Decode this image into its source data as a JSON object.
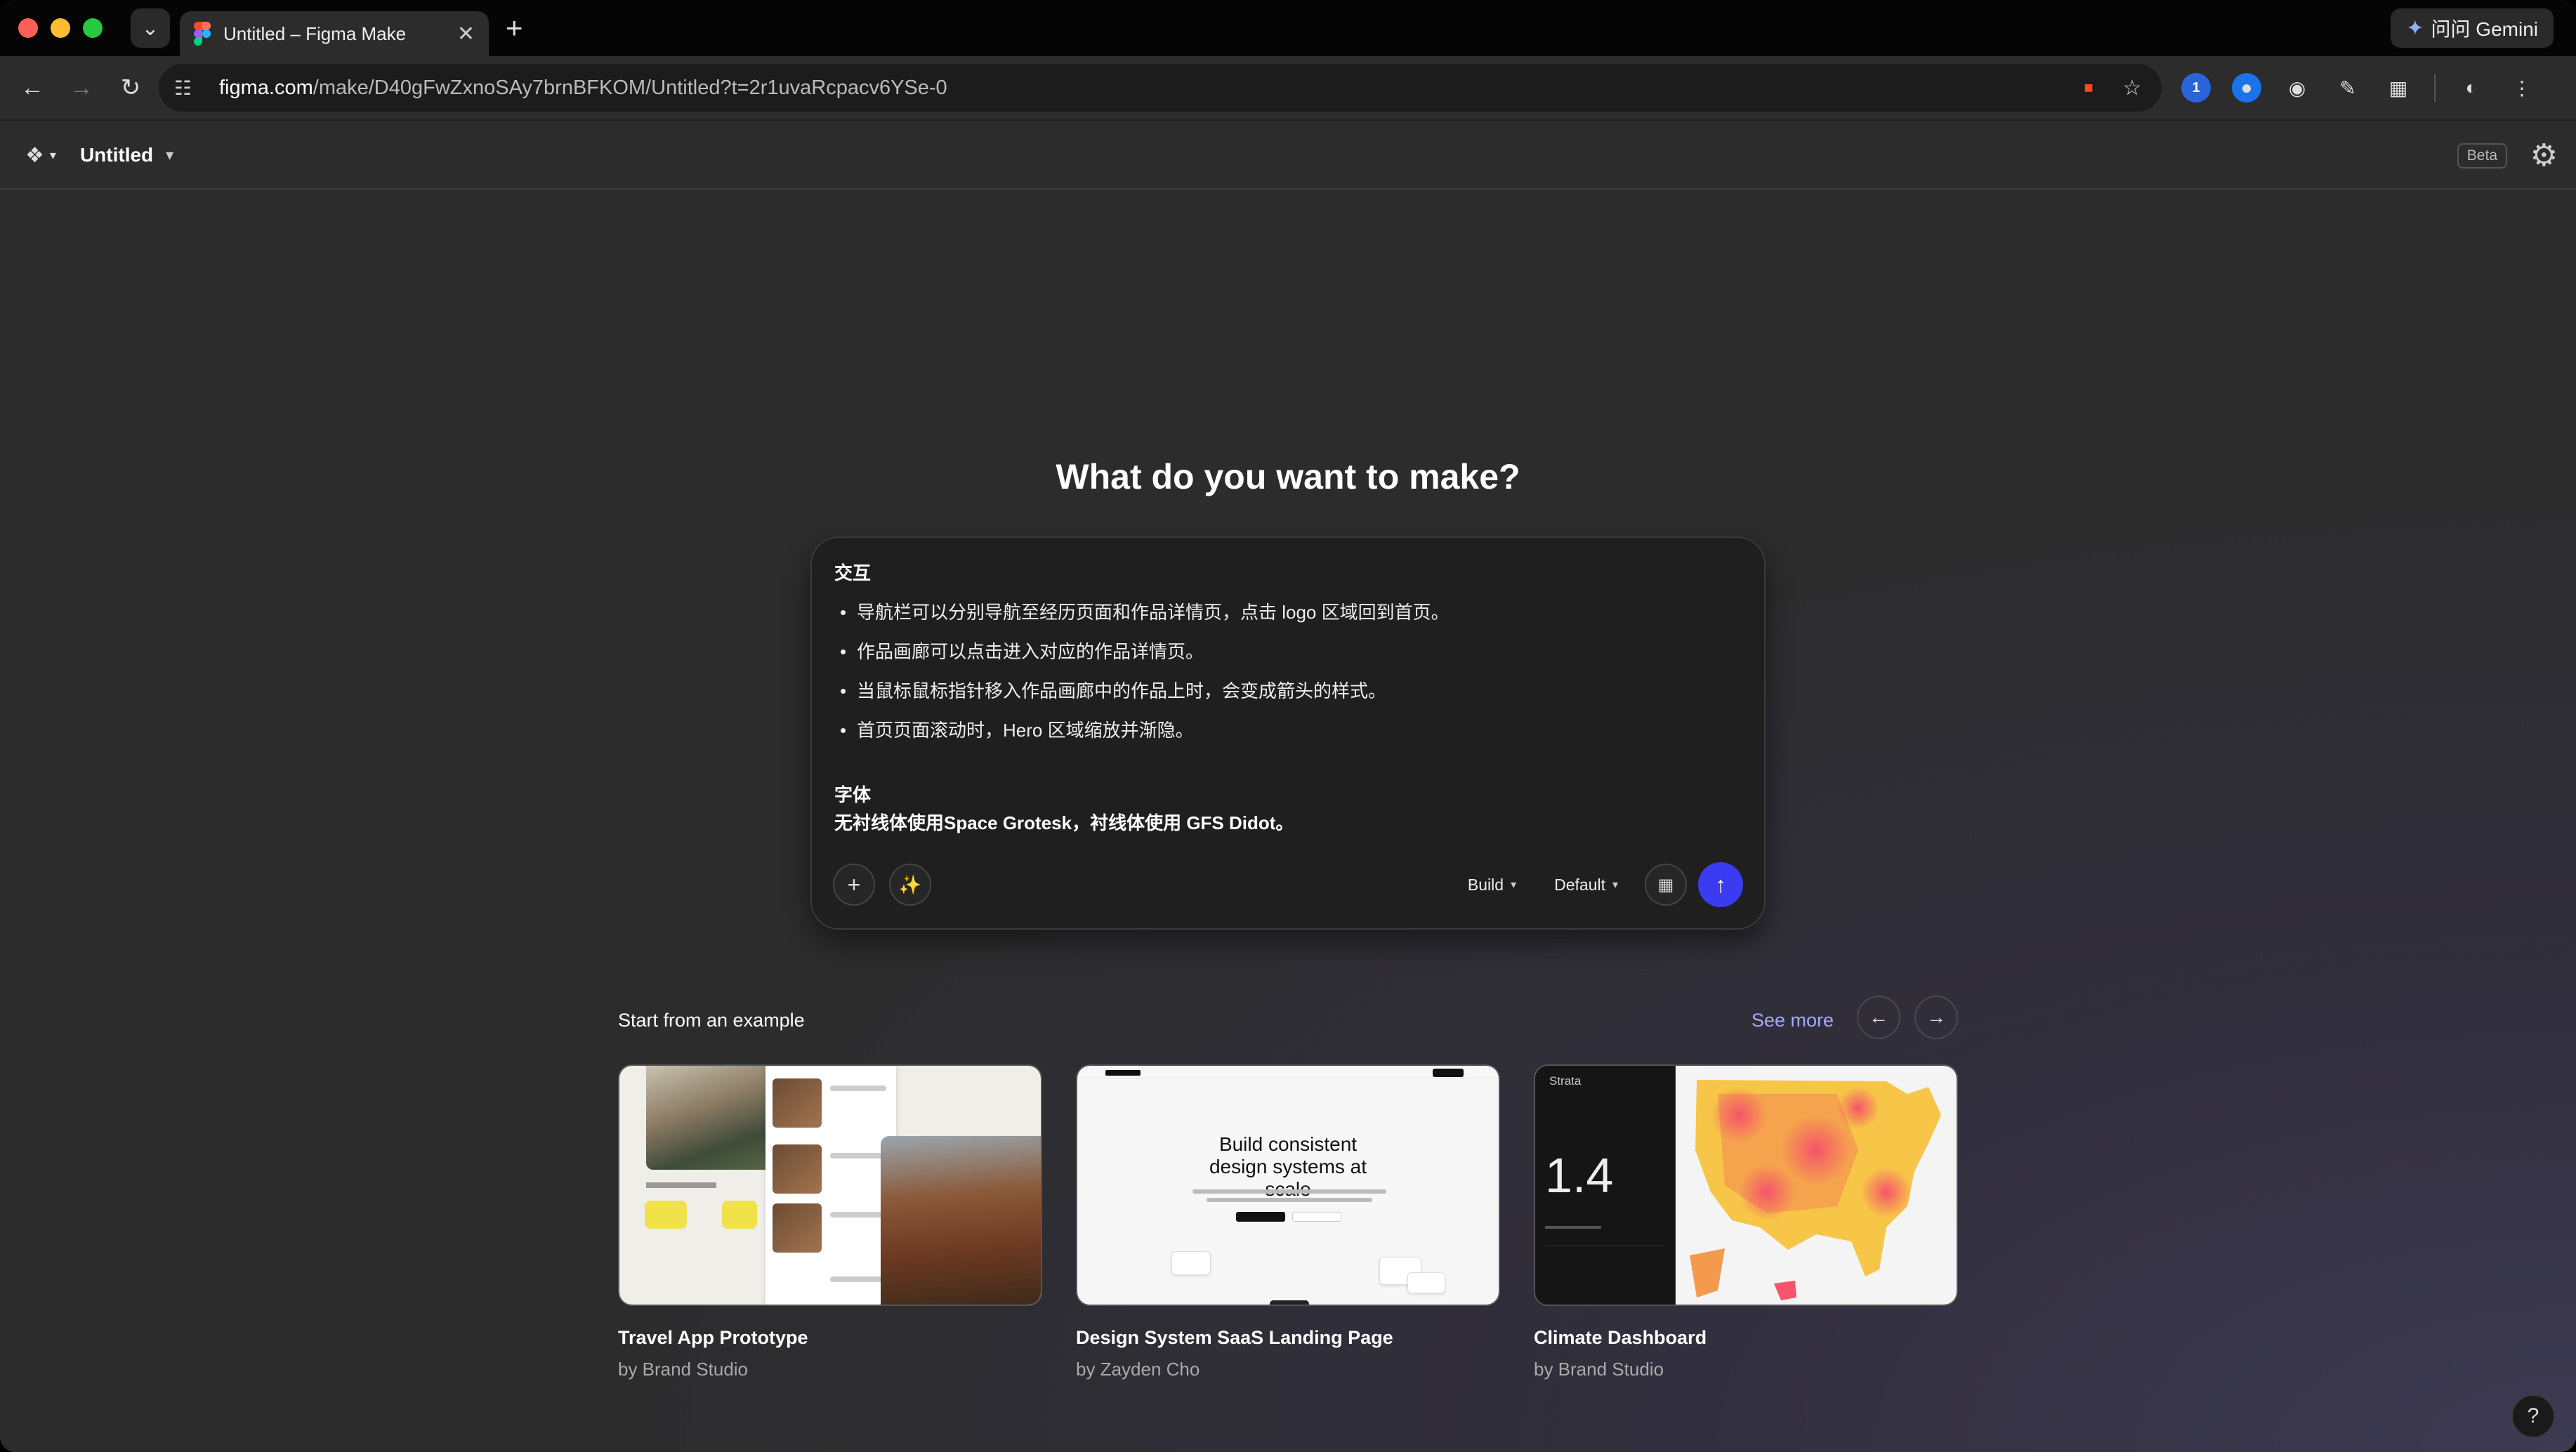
{
  "browser": {
    "tab_title": "Untitled – Figma Make",
    "url_host": "figma.com",
    "url_path": "/make/D40gFwZxnoSAy7brnBFKOM/Untitled?t=2r1uvaRcpacv6YSe-0",
    "gemini_label": "问问 Gemini"
  },
  "app": {
    "file_name": "Untitled",
    "beta_label": "Beta"
  },
  "main": {
    "headline": "What do you want to make?",
    "prompt": {
      "section1_title": "交互",
      "bullets": [
        "导航栏可以分别导航至经历页面和作品详情页，点击 logo 区域回到首页。",
        "作品画廊可以点击进入对应的作品详情页。",
        "当鼠标鼠标指针移入作品画廊中的作品上时，会变成箭头的样式。",
        "首页页面滚动时，Hero 区域缩放并渐隐。"
      ],
      "section2_title": "字体",
      "section2_text": "无衬线体使用Space Grotesk，衬线体使用 GFS Didot。"
    },
    "toolbar": {
      "mode_label": "Build",
      "model_label": "Default"
    },
    "examples": {
      "heading": "Start from an example",
      "see_more": "See more",
      "cards": [
        {
          "title": "Travel App Prototype",
          "author": "by Brand Studio"
        },
        {
          "title": "Design System SaaS Landing Page",
          "author": "by Zayden Cho"
        },
        {
          "title": "Climate Dashboard",
          "author": "by Brand Studio"
        }
      ],
      "thumb_design_heading": "Build consistent design systems at scale",
      "thumb_climate_brand": "Strata",
      "thumb_climate_number": "1.4"
    }
  },
  "colors": {
    "accent": "#3b3bf2",
    "link": "#a6a8ff",
    "background": "#2c2c2c"
  },
  "icons": {
    "back": "arrow-left-icon",
    "forward": "arrow-right-icon",
    "reload": "reload-icon",
    "star": "bookmark-star-icon",
    "settings": "gear-icon",
    "add": "plus-icon",
    "enhance": "magic-wand-icon",
    "send": "arrow-up-icon",
    "help": "question-icon"
  }
}
